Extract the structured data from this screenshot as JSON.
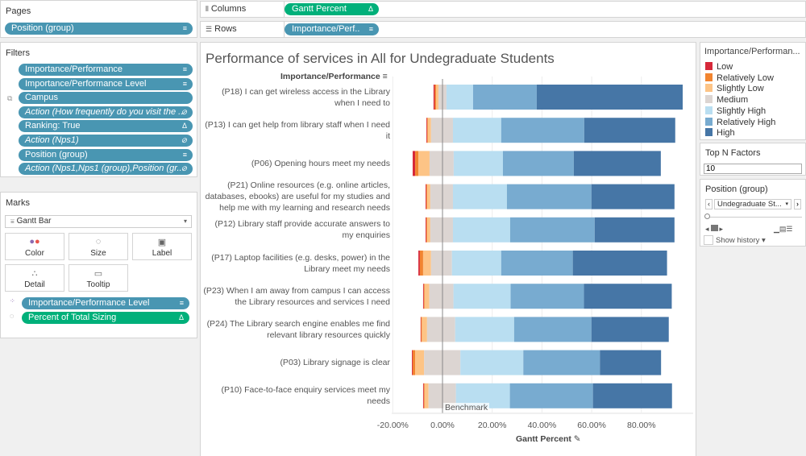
{
  "pages": {
    "title": "Pages",
    "pill": "Position (group)",
    "pill_icon": "sort-icon"
  },
  "filters": {
    "title": "Filters",
    "items": [
      {
        "label": "Importance/Performance",
        "icon": "sort-desc-icon",
        "italic": false
      },
      {
        "label": "Importance/Performance Level",
        "icon": "sort-icon",
        "italic": false
      },
      {
        "label": "Campus",
        "icon": "",
        "italic": false
      },
      {
        "label": "Action (How frequently do you visit the ..",
        "icon": "link-icon",
        "italic": true
      },
      {
        "label": "Ranking: True",
        "icon": "delta-icon",
        "italic": false
      },
      {
        "label": "Action (Nps1)",
        "icon": "link-icon",
        "italic": true
      },
      {
        "label": "Position (group)",
        "icon": "sort-icon",
        "italic": false
      },
      {
        "label": "Action (Nps1,Nps1 (group),Position (gr..",
        "icon": "link-icon",
        "italic": true
      }
    ]
  },
  "marks": {
    "title": "Marks",
    "type": "Gantt Bar",
    "buttons": [
      "Color",
      "Size",
      "Label",
      "Detail",
      "Tooltip"
    ],
    "pills": [
      {
        "label": "Importance/Performance Level",
        "icon": "sort-icon"
      },
      {
        "label": "Percent of Total Sizing",
        "icon": "delta-icon"
      }
    ]
  },
  "shelves": {
    "columns_label": "Columns",
    "columns_pill": "Gantt Percent",
    "rows_label": "Rows",
    "rows_pill": "Importance/Perf.."
  },
  "legend": {
    "title": "Importance/Performan...",
    "items": [
      {
        "label": "Low",
        "color": "#d62839"
      },
      {
        "label": "Relatively Low",
        "color": "#f28530"
      },
      {
        "label": "Slightly Low",
        "color": "#fdc486"
      },
      {
        "label": "Medium",
        "color": "#dcd5d2"
      },
      {
        "label": "Slightly High",
        "color": "#b9def1"
      },
      {
        "label": "Relatively High",
        "color": "#78abd0"
      },
      {
        "label": "High",
        "color": "#4676a6"
      }
    ]
  },
  "topn": {
    "title": "Top N Factors",
    "value": "10"
  },
  "position_filter": {
    "title": "Position (group)",
    "value": "Undegraduate St...",
    "show_history": "Show history"
  },
  "chart_data": {
    "type": "bar",
    "subtype": "diverging stacked gantt",
    "title": "Performance of services in All for Undegraduate Students",
    "row_header": "Importance/Performance",
    "xlabel": "Gantt Percent",
    "xlim": [
      -20,
      100
    ],
    "xticks": [
      "-20.00%",
      "0.00%",
      "20.00%",
      "40.00%",
      "60.00%",
      "80.00%"
    ],
    "xtick_values": [
      -20,
      0,
      20,
      40,
      60,
      80
    ],
    "reference_line": {
      "label": "Benchmark",
      "value": 0
    },
    "series_names": [
      "Low",
      "Relatively Low",
      "Slightly Low",
      "Medium",
      "Slightly High",
      "Relatively High",
      "High"
    ],
    "categories": [
      "(P18) I can get wireless access in the Library when I need to",
      "(P13) I can get help from library staff when I need it",
      "(P06) Opening hours meet my needs",
      "(P21) Online resources (e.g. online articles, databases, ebooks) are useful for my studies and help me with my learning and research needs",
      "(P12) Library staff provide accurate answers to my enquiries",
      "(P17) Laptop facilities (e.g. desks, power) in the Library meet my needs",
      "(P23) When I am away from campus I can access the Library resources and services I need",
      "(P24) The Library search engine enables me find relevant library resources quickly",
      "(P03) Library signage is clear",
      "(P10) Face-to-face enquiry services meet my needs"
    ],
    "starts": [
      -3.6,
      -6.5,
      -12.0,
      -6.8,
      -6.8,
      -9.7,
      -7.8,
      -8.8,
      -12.3,
      -7.8
    ],
    "segments": [
      [
        0.5,
        0.5,
        1.0,
        3.2,
        10.7,
        25.6,
        58.7
      ],
      [
        0.3,
        0.3,
        1.3,
        8.8,
        19.4,
        33.4,
        36.6
      ],
      [
        1.0,
        1.3,
        4.5,
        9.7,
        19.8,
        28.5,
        35.0
      ],
      [
        0.3,
        0.3,
        1.3,
        9.1,
        21.7,
        34.0,
        33.4
      ],
      [
        0.3,
        0.3,
        1.3,
        9.1,
        23.0,
        34.0,
        32.1
      ],
      [
        0.6,
        1.3,
        3.2,
        8.4,
        19.8,
        28.8,
        37.9
      ],
      [
        0.3,
        0.3,
        1.9,
        9.7,
        23.0,
        29.5,
        35.3
      ],
      [
        0.2,
        0.3,
        2.1,
        11.3,
        23.7,
        31.1,
        31.1
      ],
      [
        0.3,
        1.0,
        3.6,
        14.6,
        25.3,
        30.8,
        24.6
      ],
      [
        0.3,
        0.3,
        1.6,
        11.0,
        21.7,
        33.4,
        31.8
      ]
    ],
    "grid": true
  },
  "row_label_lines": [
    [
      "(P18) I can get wireless access in the Library",
      "when I need to"
    ],
    [
      "(P13) I can get help from library staff when I need",
      "it"
    ],
    [
      "(P06) Opening hours meet my needs"
    ],
    [
      "(P21) Online resources (e.g. online articles,",
      "databases, ebooks) are useful for my studies and",
      "help me with my learning and research needs"
    ],
    [
      "(P12) Library staff provide accurate answers to",
      "my enquiries"
    ],
    [
      "(P17) Laptop facilities (e.g. desks, power) in the",
      "Library meet my needs"
    ],
    [
      "(P23) When I am away from campus I can access",
      "the Library resources and services I need"
    ],
    [
      "(P24) The Library search engine enables me find",
      "relevant library resources quickly"
    ],
    [
      "(P03) Library signage is clear"
    ],
    [
      "(P10) Face-to-face enquiry services meet my",
      "needs"
    ]
  ]
}
